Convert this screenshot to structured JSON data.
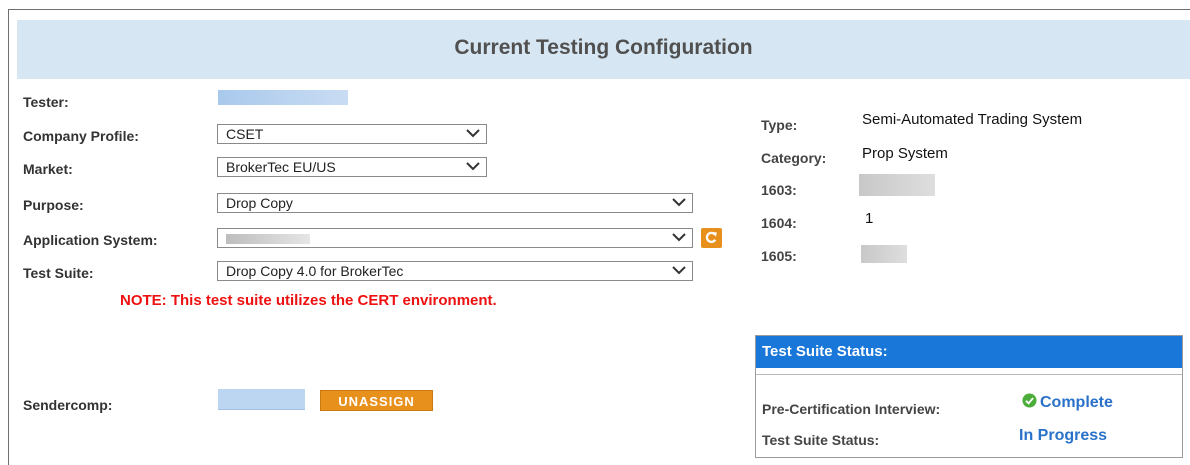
{
  "header": {
    "title": "Current Testing Configuration"
  },
  "form": {
    "tester_label": "Tester:",
    "company_label": "Company Profile:",
    "company_value": "CSET",
    "market_label": "Market:",
    "market_value": "BrokerTec EU/US",
    "purpose_label": "Purpose:",
    "purpose_value": "Drop Copy",
    "appsys_label": "Application System:",
    "suite_label": "Test Suite:",
    "suite_value": "Drop Copy 4.0 for BrokerTec",
    "note": "NOTE: This test suite utilizes the CERT environment.",
    "sendercomp_label": "Sendercomp:",
    "unassign_label": "UNASSIGN"
  },
  "details": {
    "type_label": "Type:",
    "type_value": "Semi-Automated Trading System",
    "category_label": "Category:",
    "category_value": "Prop System",
    "f1603_label": "1603:",
    "f1604_label": "1604:",
    "f1604_value": "1",
    "f1605_label": "1605:"
  },
  "status": {
    "header": "Test Suite Status:",
    "interview_label": "Pre-Certification Interview:",
    "interview_value": "Complete",
    "suite_status_label": "Test Suite Status:",
    "suite_status_value": "In Progress"
  },
  "icons": {
    "dropdown": "chevron-down-icon",
    "refresh": "refresh-icon",
    "check": "check-circle-icon"
  },
  "colors": {
    "accent_orange": "#e8901c",
    "header_blue": "#1877d8",
    "link_blue": "#2a72c9",
    "note_red": "#ee1111",
    "title_bg": "#d6e6f2"
  }
}
